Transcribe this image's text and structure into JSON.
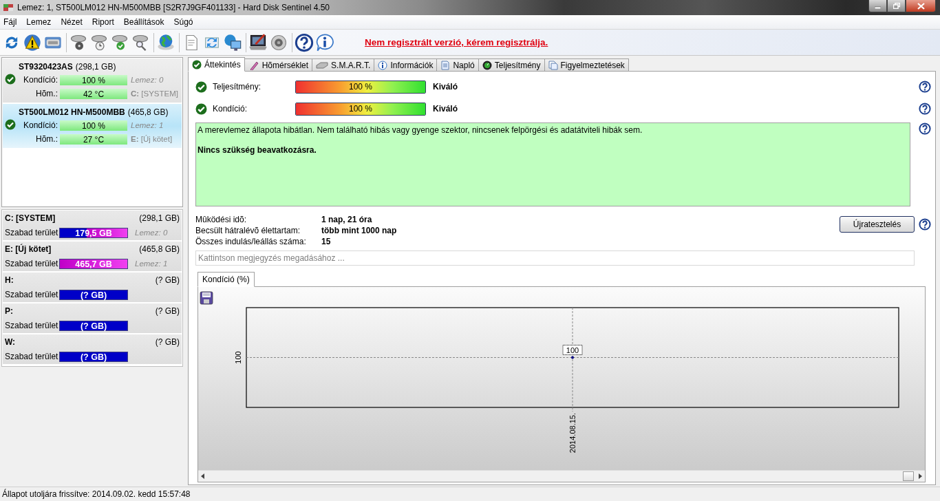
{
  "window": {
    "title": "Lemez: 1, ST500LM012 HN-M500MBB [S2R7J9GF401133]  -  Hard Disk Sentinel 4.50"
  },
  "menu": [
    "Fájl",
    "Lemez",
    "Nézet",
    "Riport",
    "Beállítások",
    "Súgó"
  ],
  "toolbar": {
    "register_link": "Nem regisztrált verzió, kérem regisztrálja."
  },
  "disks": [
    {
      "name": "ST9320423AS",
      "size": "(298,1 GB)",
      "selected": false,
      "condition": {
        "label": "Kondíció:",
        "level": 1,
        "reading": "100 %"
      },
      "temperature": {
        "label": "Hõm.:",
        "reading": "42 °C"
      },
      "disk_index": "Lemez: 0",
      "partition": "**C:** [SYSTEM]"
    },
    {
      "name": "ST500LM012 HN-M500MBB",
      "size": "(465,8 GB)",
      "selected": true,
      "condition": {
        "label": "Kondíció:",
        "level": 1,
        "reading": "100 %"
      },
      "temperature": {
        "label": "Hõm.:",
        "reading": "27 °C"
      },
      "disk_index": "Lemez: 1",
      "partition": "**E:** [Új kötet]"
    }
  ],
  "volumes": [
    {
      "name": "C: [SYSTEM]",
      "size": "(298,1 GB)",
      "free_label": "Szabad terület",
      "level": 0.6,
      "reading": "179,5 GB",
      "disk_index": "Lemez: 0"
    },
    {
      "name": "E: [Új kötet]",
      "size": "(465,8 GB)",
      "free_label": "Szabad terület",
      "level": 1,
      "reading": "465,7 GB",
      "disk_index": "Lemez: 1"
    },
    {
      "name": "H:",
      "size": "(? GB)",
      "free_label": "Szabad terület",
      "reading": "(? GB)"
    },
    {
      "name": "P:",
      "size": "(? GB)",
      "free_label": "Szabad terület",
      "reading": "(? GB)"
    },
    {
      "name": "W:",
      "size": "(? GB)",
      "free_label": "Szabad terület",
      "reading": "(? GB)"
    }
  ],
  "tabs": [
    {
      "label": "Áttekintés",
      "selected": true
    },
    {
      "label": "Hõmérséklet",
      "selected": false
    },
    {
      "label": "S.M.A.R.T.",
      "selected": false
    },
    {
      "label": "Információk",
      "selected": false
    },
    {
      "label": "Napló",
      "selected": false
    },
    {
      "label": "Teljesítmény",
      "selected": false
    },
    {
      "label": "Figyelmeztetések",
      "selected": false
    }
  ],
  "overview": {
    "metrics": [
      {
        "label": "Teljesítmény:",
        "level": 1,
        "reading": "100 %",
        "rating": "Kiváló"
      },
      {
        "label": "Kondíció:",
        "level": 1,
        "reading": "100 %",
        "rating": "Kiváló"
      }
    ],
    "message": {
      "text": "A merevlemez állapota hibátlan. Nem található hibás vagy gyenge szektor, nincsenek felpörgési és adatátviteli hibák sem.",
      "emphasis": "Nincs szükség beavatkozásra."
    },
    "details": [
      {
        "label": "Mûködési idõ:",
        "value": "1 nap, 21 óra"
      },
      {
        "label": "Becsült hátralévõ élettartam:",
        "value": "több mint 1000 nap"
      },
      {
        "label": "Összes indulás/leállás száma:",
        "value": "15"
      }
    ],
    "retest_button": "Újratesztelés",
    "note": {
      "placeholder": "Kattintson megjegyzés megadásához ..."
    },
    "chart_tab": {
      "label": "Kondíció  (%)",
      "selected": true
    },
    "chart": {
      "axis_value": "100",
      "date_label": "2014.08.15.",
      "point_label": "100"
    }
  },
  "status_bar": "Állapot utoljára frissítve: 2014.09.02. kedd 15:57:48"
}
